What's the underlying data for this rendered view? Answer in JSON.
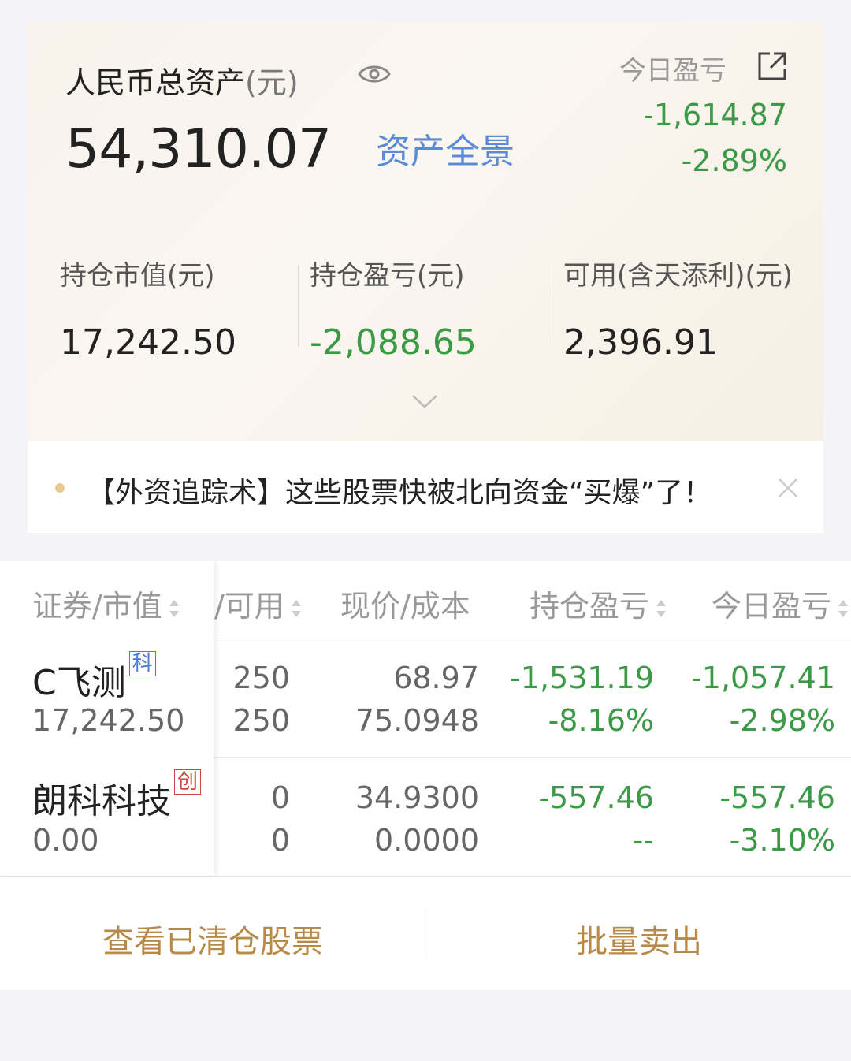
{
  "asset": {
    "total_label": "人民币总资产",
    "total_unit": "(元)",
    "total_value": "54,310.07",
    "panorama_link": "资产全景",
    "today_label": "今日盈亏",
    "today_amount": "-1,614.87",
    "today_percent": "-2.89%",
    "stats": [
      {
        "label": "持仓市值(元)",
        "value": "17,242.50"
      },
      {
        "label": "持仓盈亏(元)",
        "value": "-2,088.65"
      },
      {
        "label": "可用(含天添利)(元)",
        "value": "2,396.91"
      }
    ]
  },
  "news": {
    "text": "【外资追踪术】这些股票快被北向资金“买爆”了！"
  },
  "table": {
    "headers": {
      "security": "证券/市值",
      "available": "/可用",
      "price": "现价/成本",
      "position_pl": "持仓盈亏",
      "today_pl": "今日盈亏"
    },
    "rows": [
      {
        "name": "C飞测",
        "badge": "科",
        "market_value": "17,242.50",
        "holding": "250",
        "available": "250",
        "price": "68.97",
        "cost": "75.0948",
        "pl": "-1,531.19",
        "pl_pct": "-8.16%",
        "today_pl": "-1,057.41",
        "today_pct": "-2.98%"
      },
      {
        "name": "朗科科技",
        "badge": "创",
        "market_value": "0.00",
        "holding": "0",
        "available": "0",
        "price": "34.9300",
        "cost": "0.0000",
        "pl": "-557.46",
        "pl_pct": "--",
        "today_pl": "-557.46",
        "today_pct": "-3.10%"
      }
    ]
  },
  "footer": {
    "view_cleared": "查看已清仓股票",
    "batch_sell": "批量卖出"
  },
  "colors": {
    "green": "#3a9a46",
    "link_blue": "#5b8bd8",
    "gold": "#b88a4a"
  }
}
